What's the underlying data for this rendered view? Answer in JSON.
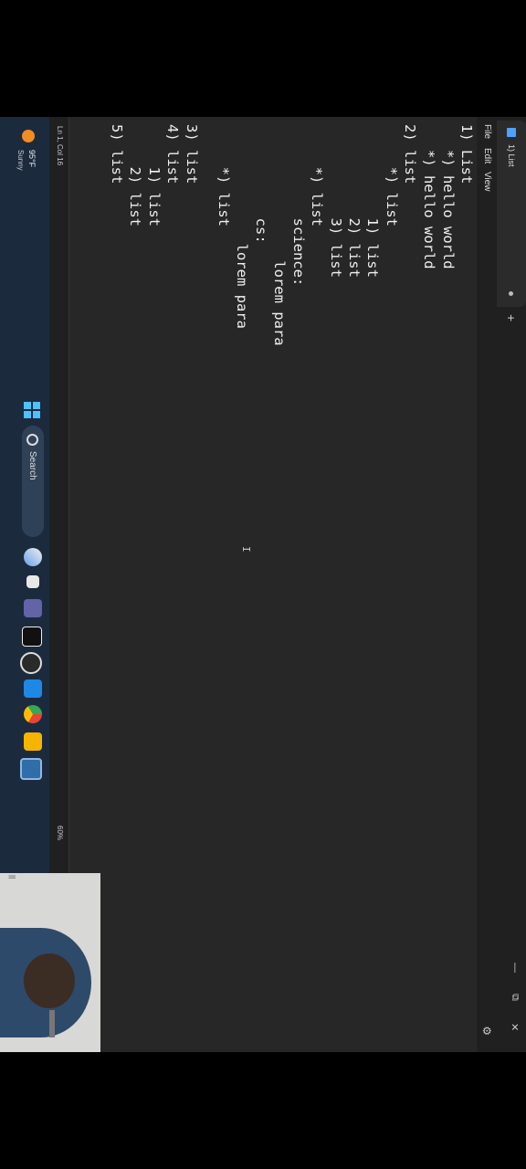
{
  "window": {
    "tab_title": "1) List",
    "new_tab_symbol": "+",
    "minimize_symbol": "—",
    "maximize_symbol": "⧉",
    "close_symbol": "✕"
  },
  "menu": {
    "file": "File",
    "edit": "Edit",
    "view": "View",
    "settings_icon": "gear-icon",
    "settings_symbol": "⚙"
  },
  "editor": {
    "lines": [
      "1) List",
      "   *) hello world",
      "   *) hello world",
      "2) list",
      "     *) list",
      "           1) list",
      "           2) list",
      "           3) list",
      "     *) list",
      "           science:",
      "                lorem para",
      "           cs:",
      "              lorem para",
      "     *) list",
      "3) list",
      "4) list",
      "     1) list",
      "     2) list",
      "5) list"
    ],
    "caret_symbol": "I"
  },
  "status": {
    "position": "Ln 1, Col 16",
    "zoom": "60%"
  },
  "taskbar": {
    "weather_temp": "95°F",
    "weather_cond": "Sunny",
    "search_label": "Search",
    "icons": [
      "start-icon",
      "copilot-icon",
      "task-view-icon",
      "teams-icon",
      "capcut-icon",
      "clock-icon",
      "vscode-icon",
      "chrome-icon",
      "file-explorer-icon",
      "notepad-icon"
    ]
  },
  "webcam": {
    "handle_symbol": "||"
  },
  "colors": {
    "editor_bg": "#272727",
    "chrome_bg": "#202020",
    "taskbar_bg": "#1c2a3e",
    "accent": "#4cc2ff"
  }
}
